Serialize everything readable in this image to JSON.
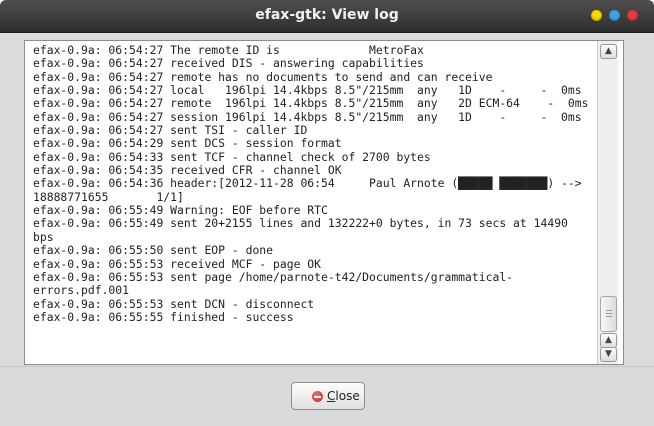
{
  "window": {
    "title": "efax-gtk: View log",
    "controls": {
      "minimize_color": "#f5d800",
      "maximize_color": "#3aa5e8",
      "close_color": "#e63c3c"
    }
  },
  "log": {
    "lines": [
      "efax-0.9a: 06:54:27 The remote ID is             MetroFax",
      "efax-0.9a: 06:54:27 received DIS - answering capabilities",
      "efax-0.9a: 06:54:27 remote has no documents to send and can receive",
      "efax-0.9a: 06:54:27 local   196lpi 14.4kbps 8.5\"/215mm  any   1D    -     -  0ms",
      "efax-0.9a: 06:54:27 remote  196lpi 14.4kbps 8.5\"/215mm  any   2D ECM-64    -  0ms",
      "efax-0.9a: 06:54:27 session 196lpi 14.4kbps 8.5\"/215mm  any   1D    -     -  0ms",
      "efax-0.9a: 06:54:27 sent TSI - caller ID",
      "efax-0.9a: 06:54:29 sent DCS - session format",
      "efax-0.9a: 06:54:33 sent TCF - channel check of 2700 bytes",
      "efax-0.9a: 06:54:35 received CFR - channel OK",
      "efax-0.9a: 06:54:36 header:[2012-11-28 06:54     Paul Arnote (█████ ███████) -->",
      "18888771655       1/1]",
      "efax-0.9a: 06:55:49 Warning: EOF before RTC",
      "efax-0.9a: 06:55:49 sent 20+2155 lines and 132222+0 bytes, in 73 secs at 14490",
      "bps",
      "efax-0.9a: 06:55:50 sent EOP - done",
      "efax-0.9a: 06:55:53 received MCF - page OK",
      "efax-0.9a: 06:55:53 sent page /home/parnote-t42/Documents/grammatical-",
      "errors.pdf.001",
      "efax-0.9a: 06:55:53 sent DCN - disconnect",
      "efax-0.9a: 06:55:55 finished - success"
    ]
  },
  "scrollbar": {
    "up_icon": "chevron-up-icon",
    "down_icon": "chevron-down-icon",
    "position": 1.0
  },
  "footer": {
    "close_button": {
      "mnemonic": "C",
      "rest": "lose",
      "icon": "close-icon"
    }
  }
}
